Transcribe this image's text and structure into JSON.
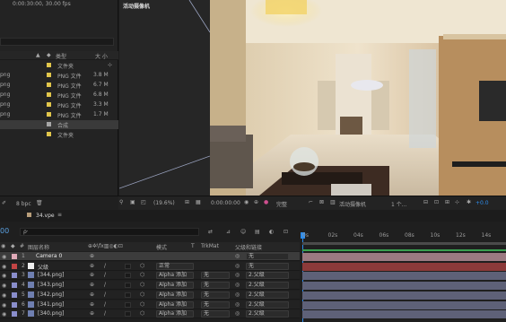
{
  "project": {
    "file_info": "0:00:30:00, 30.00 fps",
    "headers": {
      "type": "类型",
      "size": "大 小"
    },
    "items": [
      {
        "name": "",
        "type": "文件夹",
        "size": "",
        "color": "#e1c64b"
      },
      {
        "name": "png",
        "type": "PNG 文件",
        "size": "3.8 M",
        "color": "#e1c64b"
      },
      {
        "name": "png",
        "type": "PNG 文件",
        "size": "6.7 M",
        "color": "#e1c64b"
      },
      {
        "name": "png",
        "type": "PNG 文件",
        "size": "6.8 M",
        "color": "#e1c64b"
      },
      {
        "name": "png",
        "type": "PNG 文件",
        "size": "3.3 M",
        "color": "#e1c64b"
      },
      {
        "name": "png",
        "type": "PNG 文件",
        "size": "1.7 M",
        "color": "#e1c64b"
      },
      {
        "name": "",
        "type": "合成",
        "size": "",
        "color": "#a7a7a7"
      },
      {
        "name": "",
        "type": "文件夹",
        "size": "",
        "color": "#e1c64b"
      }
    ],
    "bpc": "8 bpc"
  },
  "viewer": {
    "camera_label": "活动摄像机",
    "zoom": "(19.6%)",
    "timecode": "0:00:00:00",
    "quality": "完整",
    "view": "活动摄像机",
    "views": "1 个...",
    "exposure": "+0.0"
  },
  "timeline": {
    "tab": "34.vpe",
    "timecode": "00",
    "search_placeholder": "ρ·",
    "col_headers": {
      "name": "图层名称",
      "mode": "模式",
      "t": "T",
      "trkmat": "TrkMat",
      "parent": "父级和链接"
    },
    "ruler": [
      "0s",
      "02s",
      "04s",
      "06s",
      "08s",
      "10s",
      "12s",
      "14s"
    ],
    "layers": [
      {
        "num": "1",
        "name": "Camera 0",
        "mode": "",
        "trkmat": "",
        "parent": "无",
        "label": "#e0aab8",
        "bar": "#9c7a82",
        "selected": true
      },
      {
        "num": "2",
        "name": "父级",
        "mode": "正常",
        "trkmat": "",
        "parent": "无",
        "label": "#c24444",
        "bar": "#8b3a3a",
        "selected": false
      },
      {
        "num": "3",
        "name": "[344.png]",
        "mode": "Alpha 添加",
        "trkmat": "无",
        "parent": "2.父级",
        "label": "#8a8ecc",
        "bar": "#5e6178",
        "selected": false
      },
      {
        "num": "4",
        "name": "[343.png]",
        "mode": "Alpha 添加",
        "trkmat": "无",
        "parent": "2.父级",
        "label": "#8a8ecc",
        "bar": "#5e6178",
        "selected": false
      },
      {
        "num": "5",
        "name": "[342.png]",
        "mode": "Alpha 添加",
        "trkmat": "无",
        "parent": "2.父级",
        "label": "#8a8ecc",
        "bar": "#5e6178",
        "selected": false
      },
      {
        "num": "6",
        "name": "[341.png]",
        "mode": "Alpha 添加",
        "trkmat": "无",
        "parent": "2.父级",
        "label": "#8a8ecc",
        "bar": "#5e6178",
        "selected": false
      },
      {
        "num": "7",
        "name": "[340.png]",
        "mode": "Alpha 添加",
        "trkmat": "无",
        "parent": "2.父级",
        "label": "#8a8ecc",
        "bar": "#5e6178",
        "selected": false
      }
    ]
  },
  "colors": {
    "accent": "#2d8ceb",
    "panel": "#232323"
  }
}
